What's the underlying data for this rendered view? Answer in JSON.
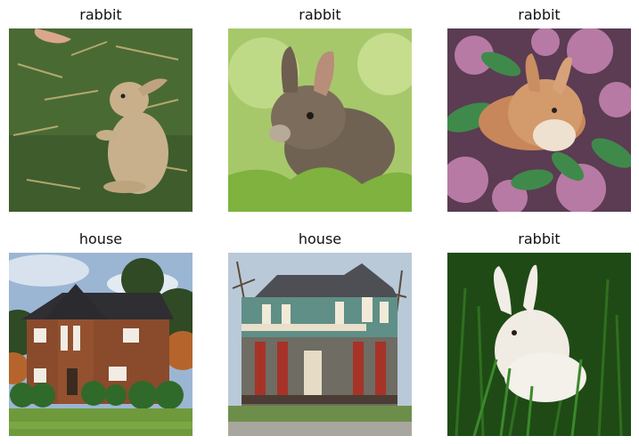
{
  "grid": {
    "items": [
      {
        "label": "rabbit",
        "subject": "brown rabbit standing on hind legs on grass with straw, hand at top-left"
      },
      {
        "label": "rabbit",
        "subject": "wild cottontail rabbit in green grass"
      },
      {
        "label": "rabbit",
        "subject": "orange-brown rabbit among purple lilac flowers and green leaves"
      },
      {
        "label": "house",
        "subject": "brick house with dark roof, trees and lawn"
      },
      {
        "label": "house",
        "subject": "green Victorian house with red trim and porch"
      },
      {
        "label": "rabbit",
        "subject": "white rabbit in tall green grass"
      }
    ]
  }
}
